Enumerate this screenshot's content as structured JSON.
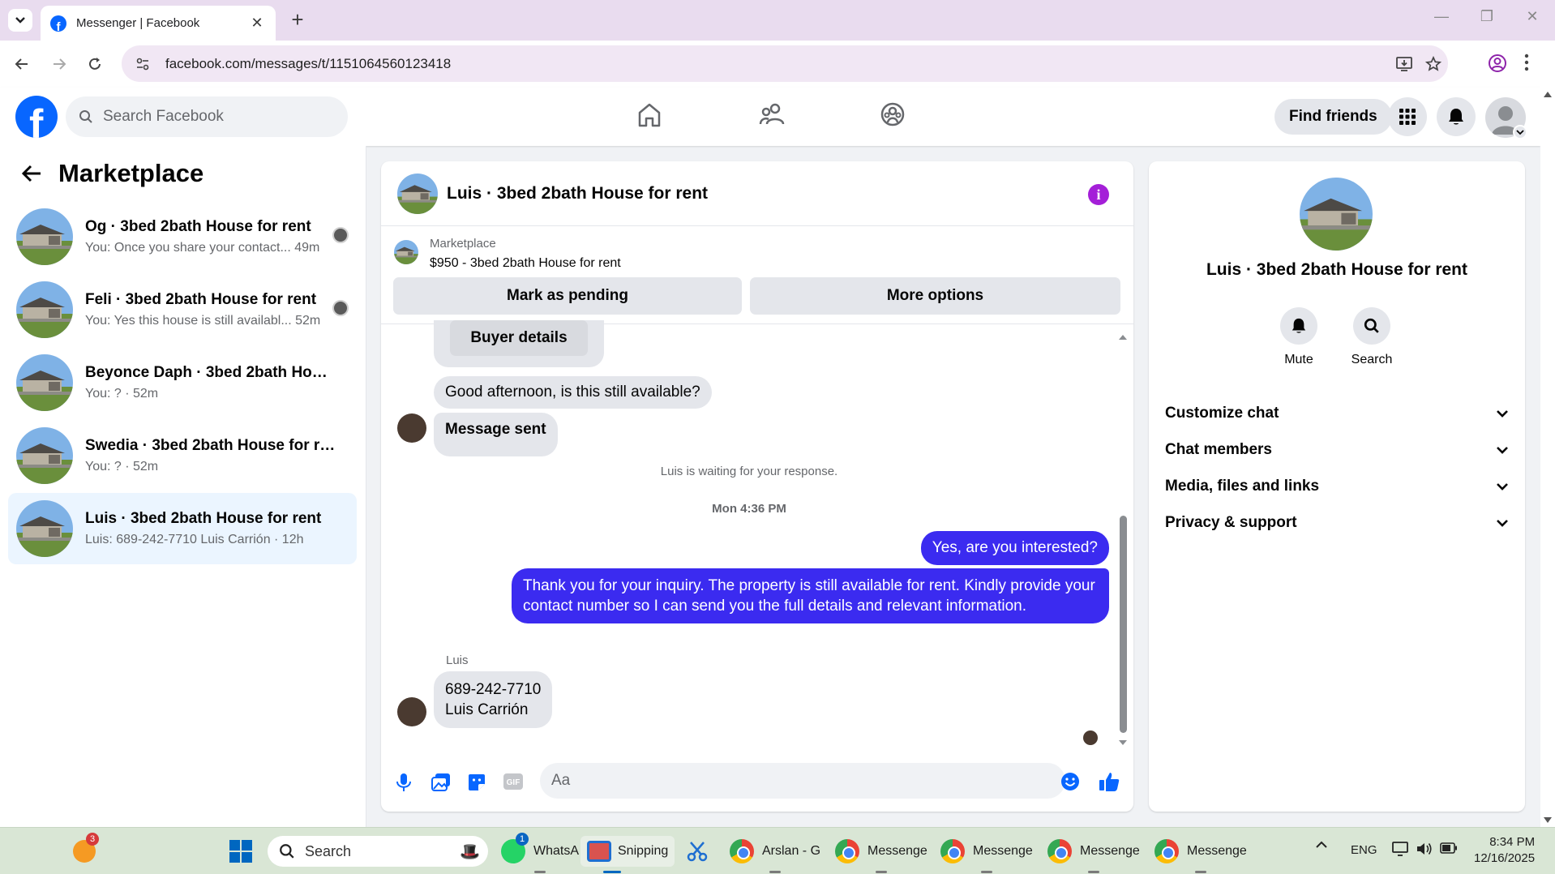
{
  "browser": {
    "tab_title": "Messenger | Facebook",
    "url": "facebook.com/messages/t/1151064560123418"
  },
  "fb": {
    "logo": "f",
    "search_placeholder": "Search Facebook",
    "find_friends": "Find friends"
  },
  "sidebar": {
    "title": "Marketplace",
    "conversations": [
      {
        "name": "Og · 3bed 2bath House for rent",
        "preview": "You: Once you share your contact... 49m",
        "active": false
      },
      {
        "name": "Feli · 3bed 2bath House for rent",
        "preview": "You: Yes this house is still availabl... 52m",
        "active": false
      },
      {
        "name": "Beyonce Daph · 3bed 2bath House...",
        "preview": "You: ? · 52m",
        "active": false
      },
      {
        "name": "Swedia · 3bed 2bath House for rent",
        "preview": "You: ? · 52m",
        "active": false
      },
      {
        "name": "Luis · 3bed 2bath House for rent",
        "preview": "Luis: 689-242-7710 Luis Carrión · 12h",
        "active": true
      }
    ]
  },
  "chat": {
    "title": "Luis · 3bed 2bath House for rent",
    "listing_label": "Marketplace",
    "listing_price": "$950 - 3bed 2bath House for rent",
    "mark_pending": "Mark as pending",
    "more_options": "More options",
    "buyer_details": "Buyer details",
    "msg_good_afternoon": "Good afternoon, is this still available?",
    "msg_sent": "Message sent",
    "waiting": "Luis is waiting for your response.",
    "timestamp": "Mon 4:36 PM",
    "out_1": "Yes, are you interested?",
    "out_2_line1": "Thank you for your inquiry. The property is still available for rent. Kindly provide your",
    "out_2_line2": "contact number so I can send you the full details and relevant information.",
    "sender_label": "Luis",
    "in_phone": "689-242-7710",
    "in_name": "Luis Carrión",
    "composer_placeholder": "Aa"
  },
  "info_panel": {
    "name": "Luis · 3bed 2bath House for rent",
    "mute": "Mute",
    "search": "Search",
    "sections": [
      "Customize chat",
      "Chat members",
      "Media, files and links",
      "Privacy & support"
    ]
  },
  "taskbar": {
    "search": "Search",
    "whatsapp": "WhatsA",
    "snipping": "Snipping",
    "arslan": "Arslan - G",
    "messenger_1": "Messenge",
    "messenger_2": "Messenge",
    "messenger_3": "Messenge",
    "messenger_4": "Messenge",
    "lang": "ENG",
    "time": "8:34 PM",
    "date": "12/16/2025",
    "weather_badge": "3",
    "whatsapp_badge": "1"
  },
  "colors": {
    "fb_blue": "#0866ff",
    "outgoing_bubble": "#3b2bf0",
    "active_conv": "#ebf5ff",
    "info_accent": "#a41fd8"
  }
}
